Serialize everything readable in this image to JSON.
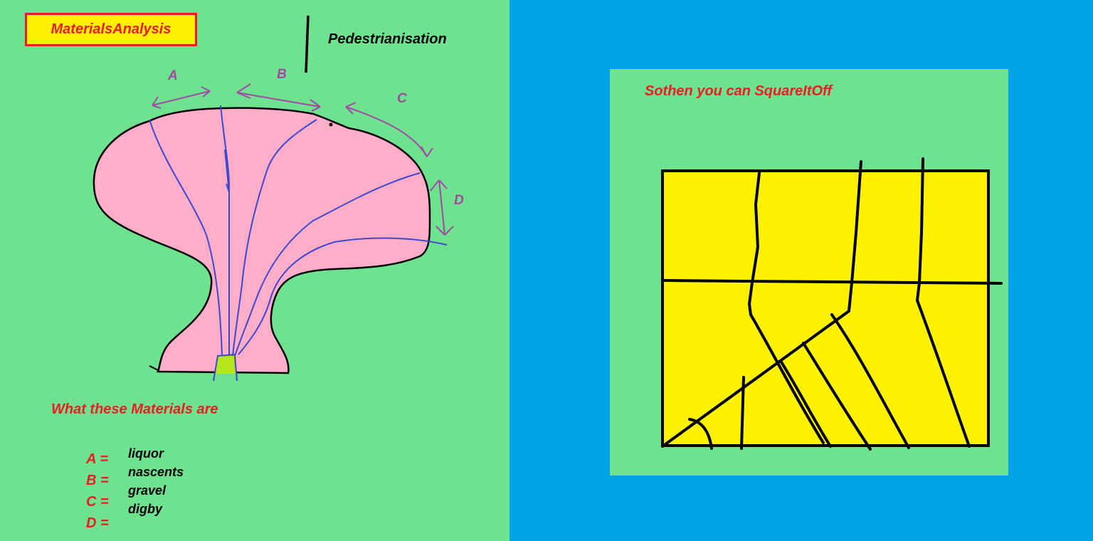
{
  "left": {
    "title": "MaterialsAnalysis",
    "pedestrianisation_label": "Pedestrianisation",
    "zones": [
      "A",
      "B",
      "C",
      "D"
    ],
    "legend_heading": "What these Materials are",
    "legend": [
      {
        "key": "A =",
        "value": "liquor"
      },
      {
        "key": "B =",
        "value": "nascents"
      },
      {
        "key": "C =",
        "value": "gravel"
      },
      {
        "key": "D =",
        "value": "digby"
      },
      {
        "key": "D =",
        "value": ""
      }
    ]
  },
  "right": {
    "caption": "Sothen you can SquareItOff"
  },
  "colors": {
    "background_green": "#6ee28f",
    "background_blue": "#00a2e8",
    "mushroom_pink": "#ffaec9",
    "stem_lime": "#b5e61d",
    "square_yellow": "#fff200",
    "vein_blue": "#3f48cc",
    "arrow_purple": "#a349a4",
    "text_red": "#ed1c24"
  }
}
